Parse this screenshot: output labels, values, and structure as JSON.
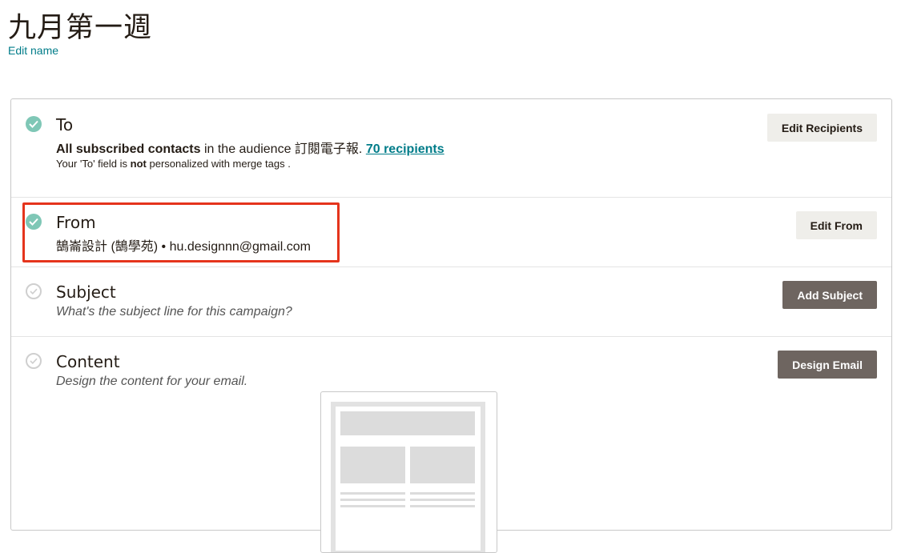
{
  "campaign": {
    "title": "九月第一週",
    "edit_name_label": "Edit name"
  },
  "sections": {
    "to": {
      "title": "To",
      "line_bold": "All subscribed contacts",
      "line_middle": " in the audience 訂閱電子報. ",
      "recipients_link": "70 recipients",
      "note_prefix": "Your 'To' field is ",
      "note_bold": "not",
      "note_suffix": " personalized with merge tags .",
      "button_label": "Edit Recipients",
      "status": "complete"
    },
    "from": {
      "title": "From",
      "value": "鵠崙設計 (鵠學苑) • hu.designnn@gmail.com",
      "button_label": "Edit From",
      "status": "complete"
    },
    "subject": {
      "title": "Subject",
      "placeholder_text": "What's the subject line for this campaign?",
      "button_label": "Add Subject",
      "status": "incomplete"
    },
    "content": {
      "title": "Content",
      "placeholder_text": "Design the content for your email.",
      "button_label": "Design Email",
      "status": "incomplete"
    }
  },
  "colors": {
    "accent_link": "#007c89",
    "check_complete": "#7fc7b6",
    "highlight_box": "#e5341c",
    "dark_button": "#6e6560",
    "light_button": "#efeeea"
  }
}
